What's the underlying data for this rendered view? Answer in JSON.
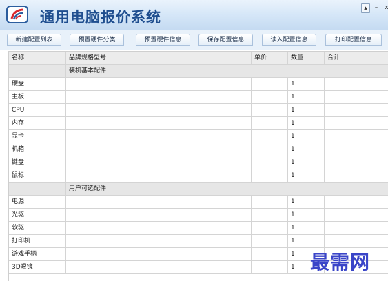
{
  "window": {
    "title": "通用电脑报价系统",
    "controls": [
      "restore",
      "minimize",
      "close"
    ]
  },
  "tabs": [
    {
      "label": "新建配置列表"
    },
    {
      "label": "预置硬件分类"
    },
    {
      "label": "预置硬件信息"
    },
    {
      "label": "保存配置信息"
    },
    {
      "label": "读入配置信息"
    },
    {
      "label": "打印配置信息"
    }
  ],
  "table": {
    "columns": [
      "名称",
      "品牌规格型号",
      "单价",
      "数量",
      "合计"
    ],
    "sections": [
      {
        "title": "装机基本配件",
        "rows": [
          {
            "name": "硬盘",
            "qty": "1"
          },
          {
            "name": "主板",
            "qty": "1"
          },
          {
            "name": "CPU",
            "qty": "1"
          },
          {
            "name": "内存",
            "qty": "1"
          },
          {
            "name": "显卡",
            "qty": "1"
          },
          {
            "name": "机箱",
            "qty": "1"
          },
          {
            "name": "键盘",
            "qty": "1"
          },
          {
            "name": "鼠标",
            "qty": "1"
          }
        ]
      },
      {
        "title": "用户可选配件",
        "rows": [
          {
            "name": "电源",
            "qty": "1"
          },
          {
            "name": "光驱",
            "qty": "1"
          },
          {
            "name": "软驱",
            "qty": "1"
          },
          {
            "name": "打印机",
            "qty": "1"
          },
          {
            "name": "游戏手柄",
            "qty": "1"
          },
          {
            "name": "3D眼镜",
            "qty": "1"
          }
        ]
      }
    ]
  },
  "watermark": "最需网",
  "colors": {
    "titlebar": "#d3e5f7",
    "title_text": "#1f4e8f",
    "watermark": "#3a45c8",
    "grid_line": "#d4d4d4"
  },
  "icons": {
    "logo": "app-logo-icon"
  }
}
